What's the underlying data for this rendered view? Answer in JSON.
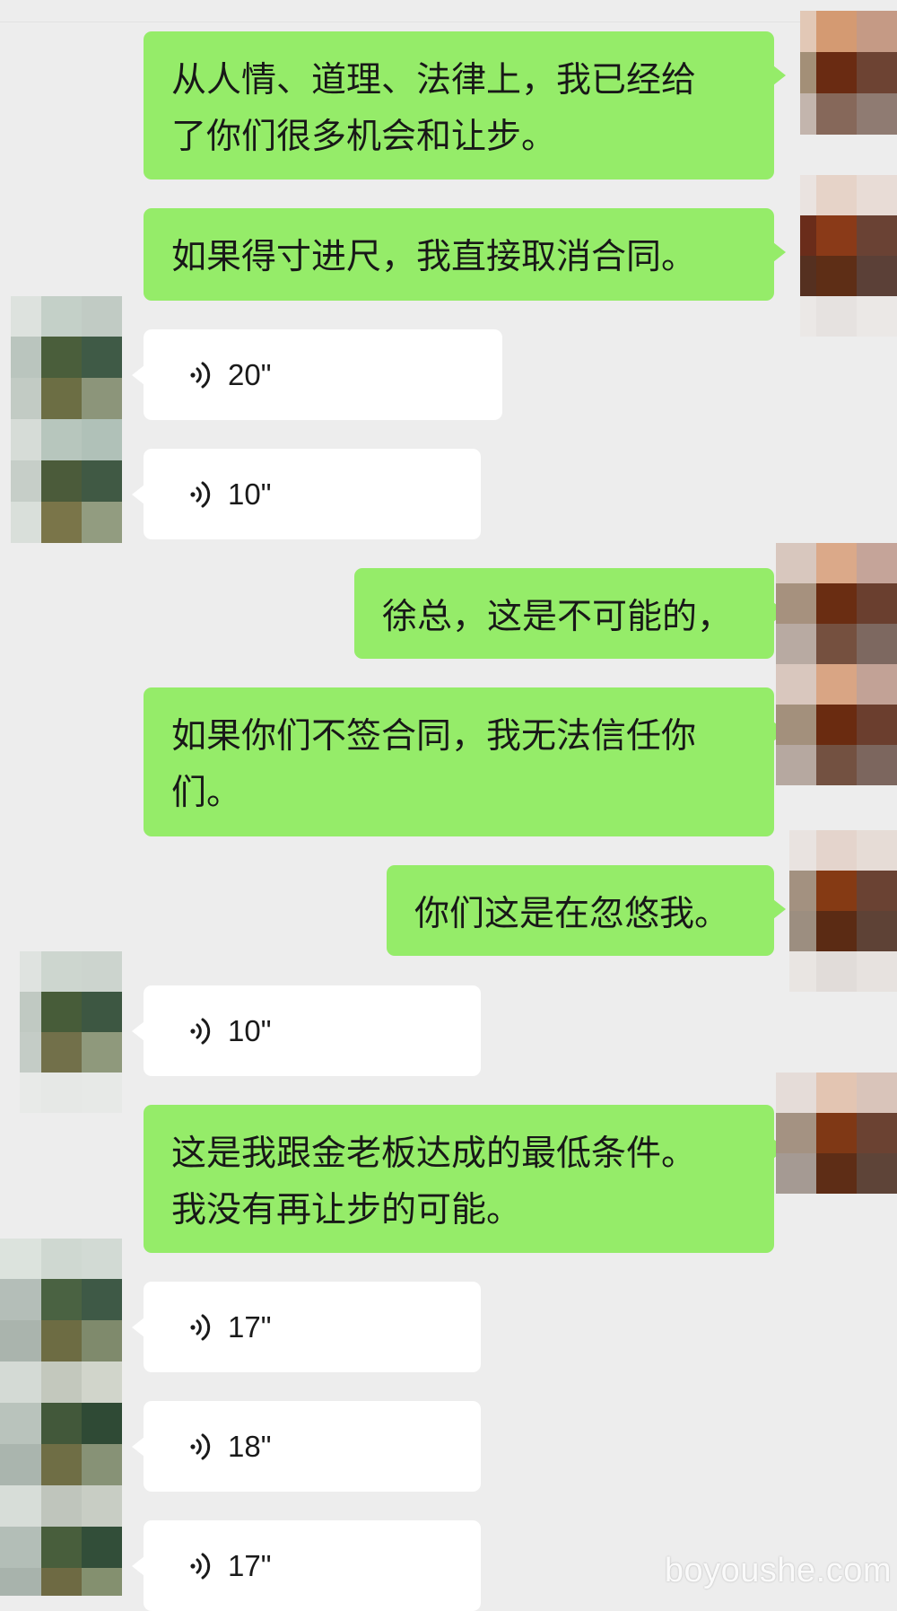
{
  "messages": [
    {
      "sender": "me",
      "text": "从人情、道理、法律上，我已经给\n了你们很多机会和让步。"
    },
    {
      "sender": "me",
      "text": "如果得寸进尺，我直接取消合同。"
    },
    {
      "sender": "other",
      "type": "voice",
      "duration": "20\""
    },
    {
      "sender": "other",
      "type": "voice",
      "duration": "10\""
    },
    {
      "sender": "me",
      "text": "徐总，这是不可能的，"
    },
    {
      "sender": "me",
      "text": "如果你们不签合同，我无法信任你\n们。"
    },
    {
      "sender": "me",
      "text": "你们这是在忽悠我。"
    },
    {
      "sender": "other",
      "type": "voice",
      "duration": "10\""
    },
    {
      "sender": "me",
      "text": "这是我跟金老板达成的最低条件。\n我没有再让步的可能。"
    },
    {
      "sender": "other",
      "type": "voice",
      "duration": "17\""
    },
    {
      "sender": "other",
      "type": "voice",
      "duration": "18\""
    },
    {
      "sender": "other",
      "type": "voice",
      "duration": "17\""
    }
  ],
  "watermark": "boyoushe.com",
  "colors": {
    "background": "#ededed",
    "my_bubble": "#95ec69",
    "their_bubble": "#ffffff"
  },
  "icons": {
    "voice": "voice-wave-icon",
    "avatar": "pixelated-avatar"
  }
}
